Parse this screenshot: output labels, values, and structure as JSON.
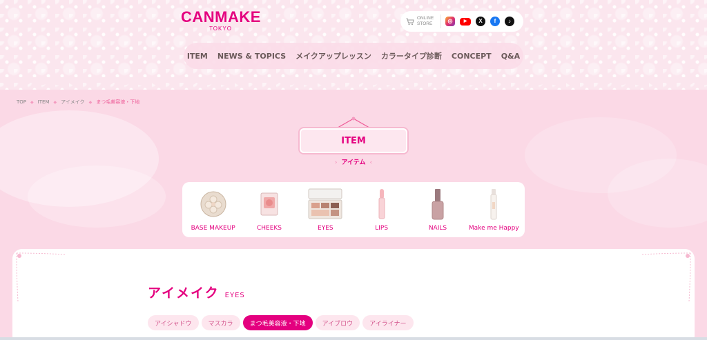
{
  "brand": {
    "logo": "CANMAKE",
    "sub": "TOKYO"
  },
  "online_store": {
    "line1": "ONLINE",
    "line2": "STORE"
  },
  "sns": [
    {
      "name": "instagram-icon",
      "glyph": "◎"
    },
    {
      "name": "youtube-icon",
      "glyph": "▶"
    },
    {
      "name": "x-icon",
      "glyph": "X"
    },
    {
      "name": "facebook-icon",
      "glyph": "f"
    },
    {
      "name": "tiktok-icon",
      "glyph": "♪"
    }
  ],
  "nav": [
    "ITEM",
    "NEWS & TOPICS",
    "メイクアップレッスン",
    "カラータイプ診断",
    "CONCEPT",
    "Q&A"
  ],
  "breadcrumb": [
    "TOP",
    "ITEM",
    "アイメイク",
    "まつ毛美容液・下地"
  ],
  "page_title": {
    "en": "ITEM",
    "jp": "アイテム"
  },
  "categories": [
    "BASE MAKEUP",
    "CHEEKS",
    "EYES",
    "LIPS",
    "NAILS",
    "Make me Happy"
  ],
  "section": {
    "jp": "アイメイク",
    "en": "EYES"
  },
  "tabs": [
    {
      "label": "アイシャドウ",
      "active": false
    },
    {
      "label": "マスカラ",
      "active": false
    },
    {
      "label": "まつ毛美容液・下地",
      "active": true
    },
    {
      "label": "アイブロウ",
      "active": false
    },
    {
      "label": "アイライナー",
      "active": false
    }
  ],
  "colors": {
    "accent": "#e4007f",
    "bg": "#fbd9e6",
    "light": "#fde6ee"
  }
}
